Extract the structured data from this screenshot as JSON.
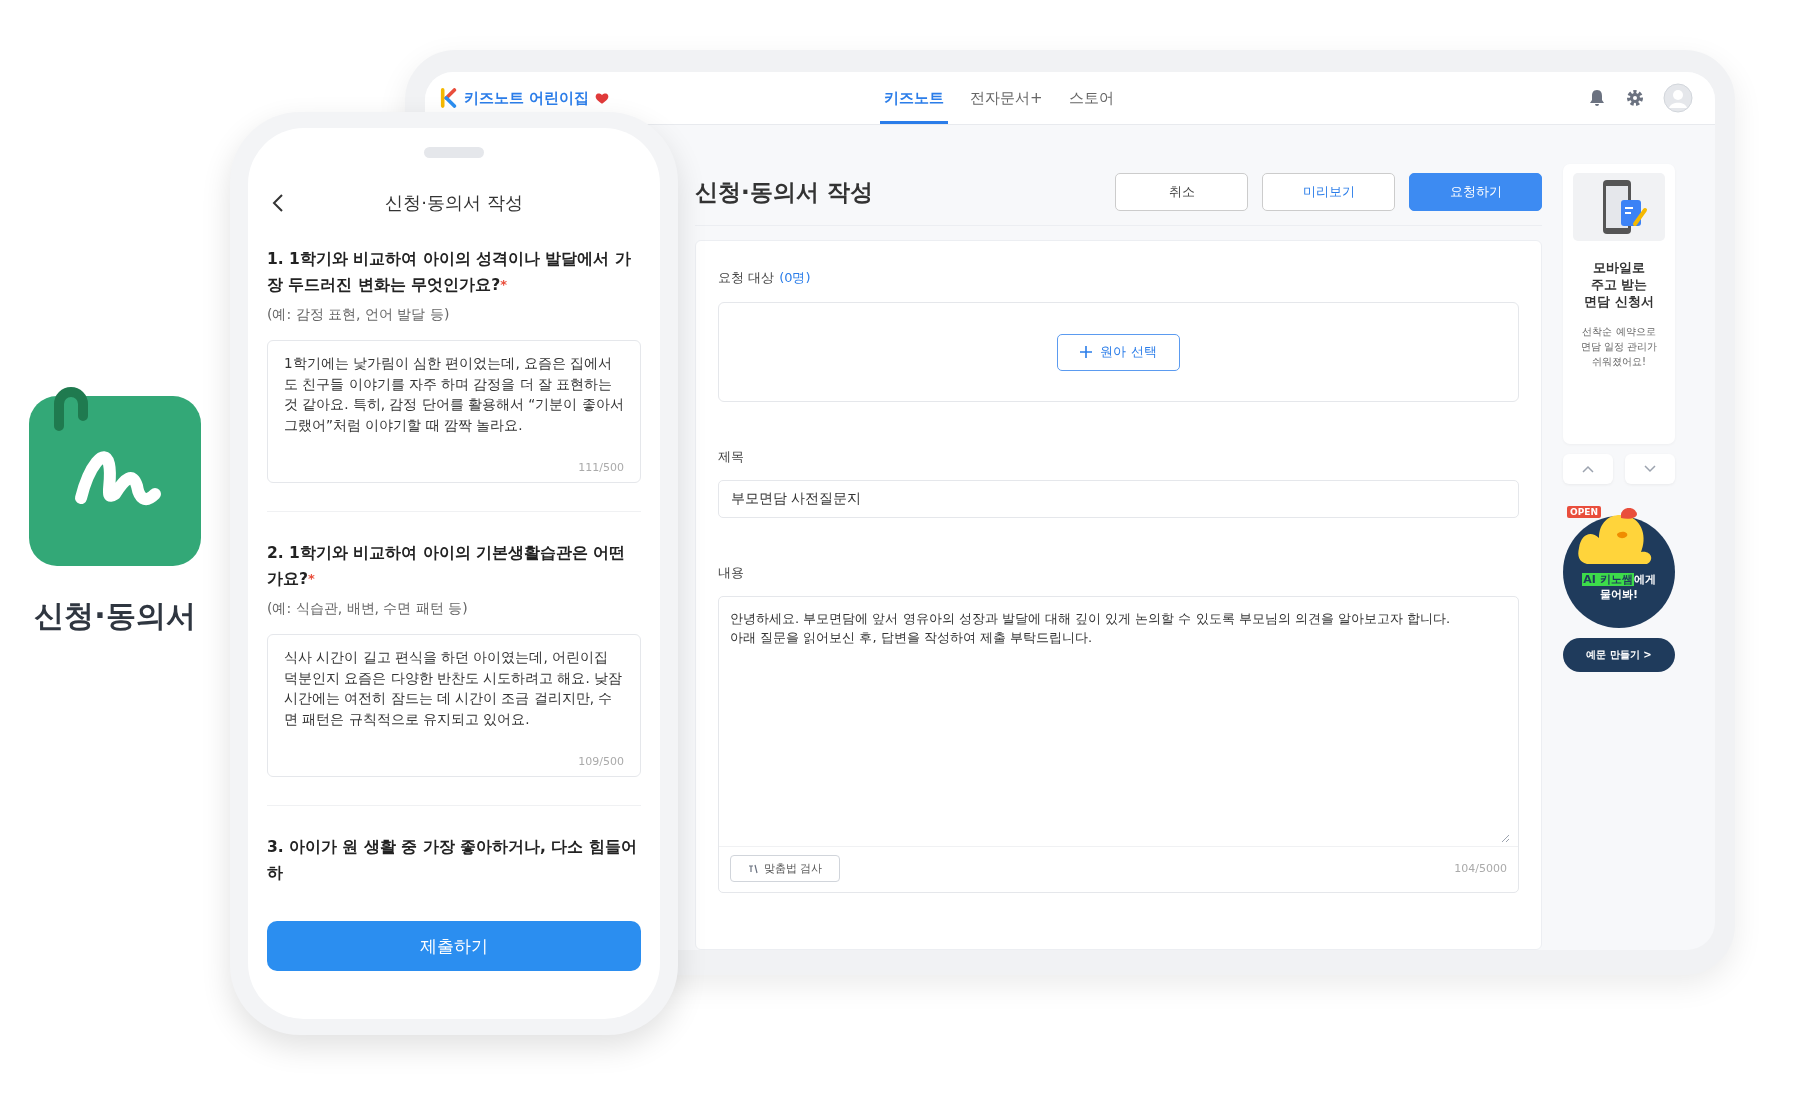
{
  "app_badge": {
    "label": "신청·동의서"
  },
  "tablet": {
    "brand": "키즈노트 어린이집",
    "nav_tabs": [
      {
        "label": "키즈노트",
        "selected": true
      },
      {
        "label": "전자문서+",
        "selected": false
      },
      {
        "label": "스토어",
        "selected": false
      }
    ],
    "page_title": "신청·동의서 작성",
    "actions": [
      {
        "label": "취소",
        "kind": "outline"
      },
      {
        "label": "미리보기",
        "kind": "outline-blue"
      },
      {
        "label": "요청하기",
        "kind": "primary"
      }
    ],
    "recipients": {
      "label": "요청 대상",
      "count": "(0명)",
      "button": "원아 선택"
    },
    "title_field": {
      "label": "제목",
      "value": "부모면담 사전질문지"
    },
    "content_field": {
      "label": "내용",
      "value": "안녕하세요. 부모면담에 앞서 영유아의 성장과 발달에 대해 깊이 있게 논의할 수 있도록 부모님의 의견을 알아보고자 합니다.\n아래 질문을 읽어보신 후, 답변을 작성하여 제출 부탁드립니다.",
      "spell_check": "맞춤법 검사",
      "counter": "104/5000"
    },
    "promo": {
      "title": "모바일로\n주고 받는\n면담 신청서",
      "text": "선착순 예약으로\n면담 일정 관리가\n쉬워졌어요!"
    },
    "ai_banner": {
      "sign": "OPEN",
      "highlight": "AI 키노쌤",
      "text": "에게\n물어봐!",
      "button": "예문 만들기 >"
    }
  },
  "phone": {
    "title": "신청·동의서 작성",
    "required_mark": "*",
    "questions": [
      {
        "title": "1. 1학기와 비교하여 아이의 성격이나 발달에서 가장 두드러진 변화는 무엇인가요?",
        "required": true,
        "hint": "(예: 감정 표현, 언어 발달 등)",
        "answer": "1학기에는 낯가림이 심한 편이었는데, 요즘은 집에서도 친구들 이야기를 자주 하며 감정을 더 잘 표현하는 것 같아요. 특히, 감정 단어를 활용해서 “기분이 좋아서 그랬어”처럼 이야기할 때 깜짝 놀라요.",
        "counter": "111/500"
      },
      {
        "title": "2. 1학기와 비교하여 아이의 기본생활습관은 어떤가요?",
        "required": true,
        "hint": "(예: 식습관, 배변, 수면 패턴 등)",
        "answer": "식사 시간이 길고 편식을 하던 아이였는데, 어린이집 덕분인지 요즘은 다양한 반찬도 시도하려고 해요. 낮잠 시간에는 여전히 잠드는 데 시간이 조금 걸리지만, 수면 패턴은 규칙적으로 유지되고 있어요.",
        "counter": "109/500"
      },
      {
        "title": "3. 아이가 원 생활 중 가장 좋아하거나, 다소 힘들어하"
      }
    ],
    "submit": "제출하기"
  }
}
